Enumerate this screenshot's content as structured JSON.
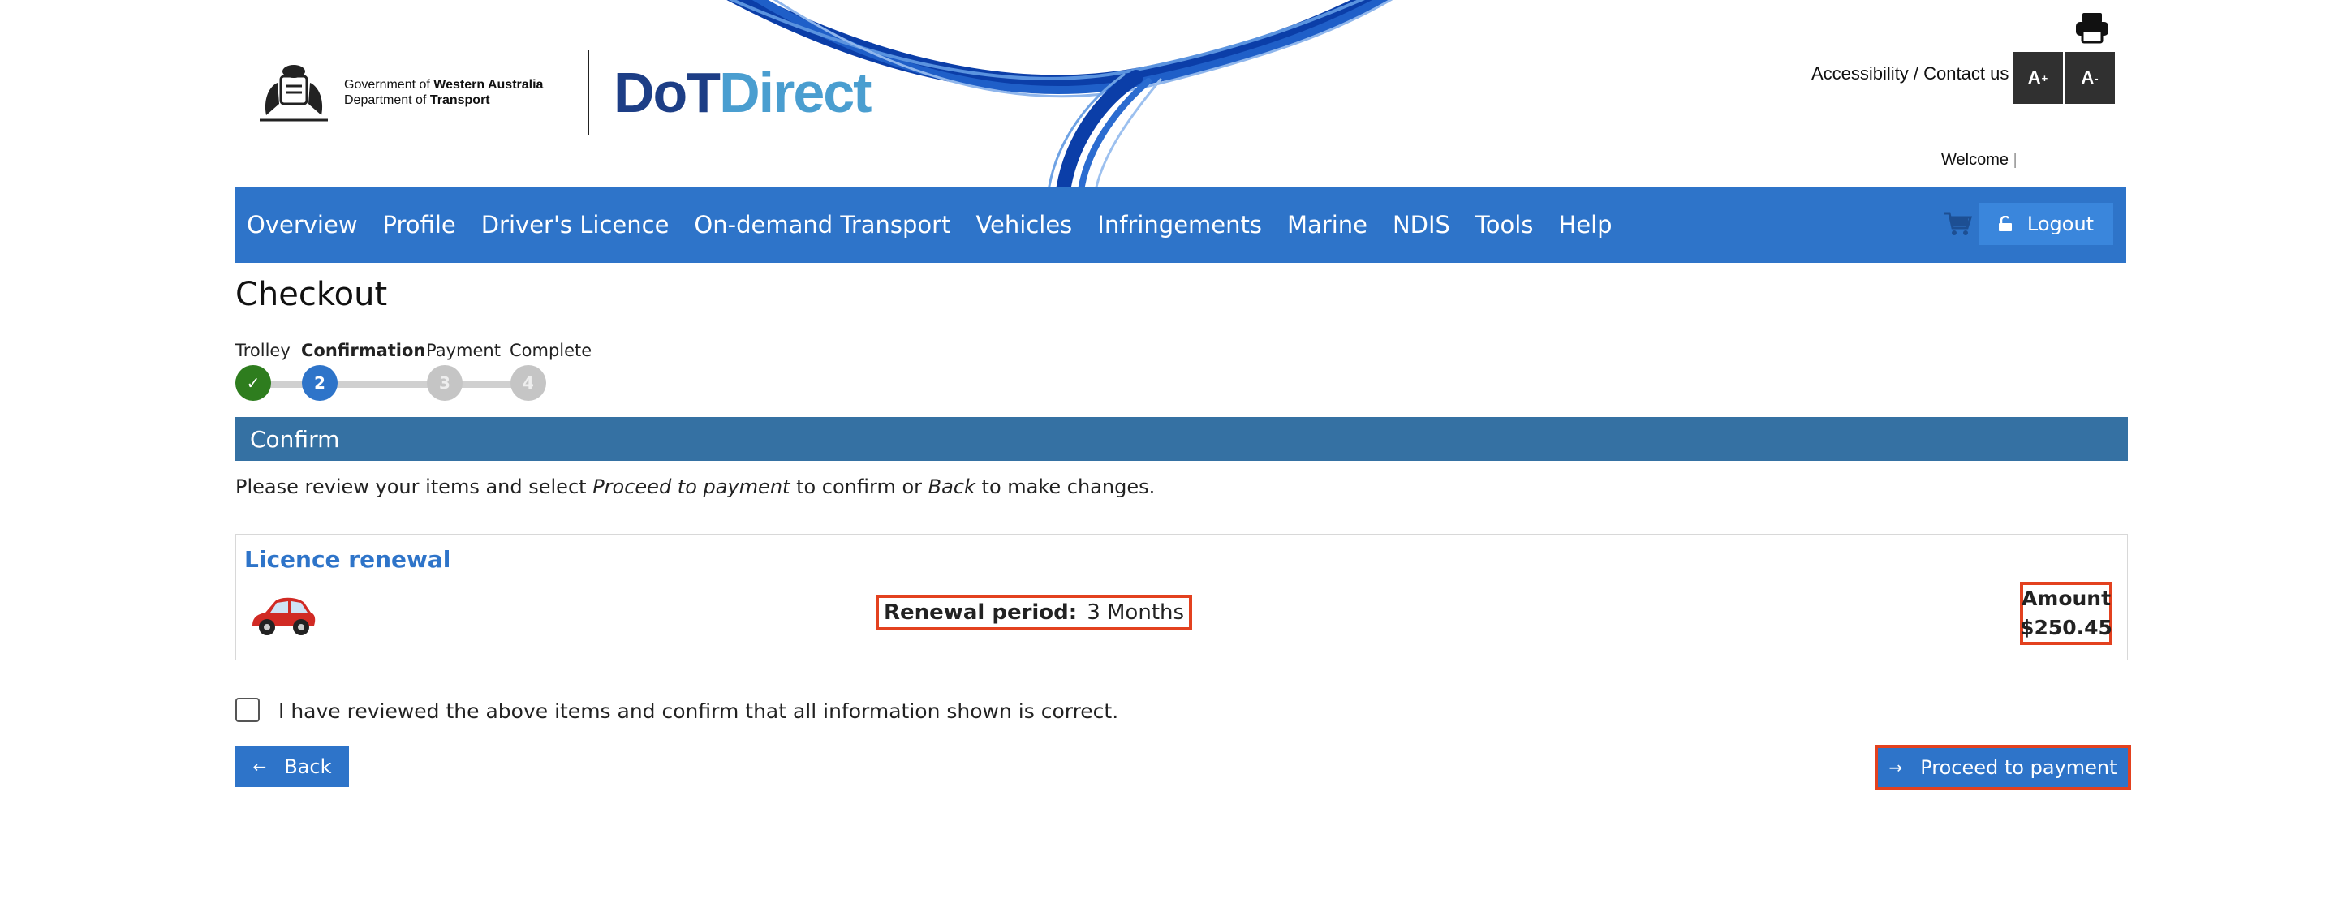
{
  "header": {
    "gov_line1_prefix": "Government of ",
    "gov_line1_bold": "Western Australia",
    "gov_line2_prefix": "Department of ",
    "gov_line2_bold": "Transport",
    "brand_part1": "DoT",
    "brand_part2": "Direct",
    "accessibility_link": "Accessibility",
    "separator": " / ",
    "contact_link": "Contact us",
    "font_increase": "A",
    "font_increase_sup": "+",
    "font_decrease": "A",
    "font_decrease_sup": "-",
    "welcome": "Welcome ",
    "welcome_cursor": "|"
  },
  "nav": {
    "items": [
      "Overview",
      "Profile",
      "Driver's Licence",
      "On-demand Transport",
      "Vehicles",
      "Infringements",
      "Marine",
      "NDIS",
      "Tools",
      "Help"
    ],
    "logout_label": "Logout"
  },
  "checkout": {
    "title": "Checkout",
    "steps": [
      {
        "label": "Trolley",
        "marker": "✓",
        "state": "done"
      },
      {
        "label": "Confirmation",
        "marker": "2",
        "state": "current"
      },
      {
        "label": "Payment",
        "marker": "3",
        "state": "todo"
      },
      {
        "label": "Complete",
        "marker": "4",
        "state": "todo"
      }
    ],
    "section_title": "Confirm",
    "instructions": {
      "part1": "Please review your items and select ",
      "italic1": "Proceed to payment",
      "part2": " to confirm or ",
      "italic2": "Back",
      "part3": " to make changes."
    },
    "item": {
      "title": "Licence renewal",
      "renewal_label": "Renewal period:",
      "renewal_value": "3 Months",
      "amount_label": "Amount",
      "amount_value": "$250.45"
    },
    "confirm_text": "I have reviewed the above items and confirm that all information shown is correct.",
    "confirm_checked": false,
    "back_label": "Back",
    "proceed_label": "Proceed to payment"
  },
  "colors": {
    "nav_blue": "#2e74c9",
    "confirm_bar": "#3571a3",
    "done_green": "#2e7d1e",
    "highlight_red": "#e3411f"
  }
}
